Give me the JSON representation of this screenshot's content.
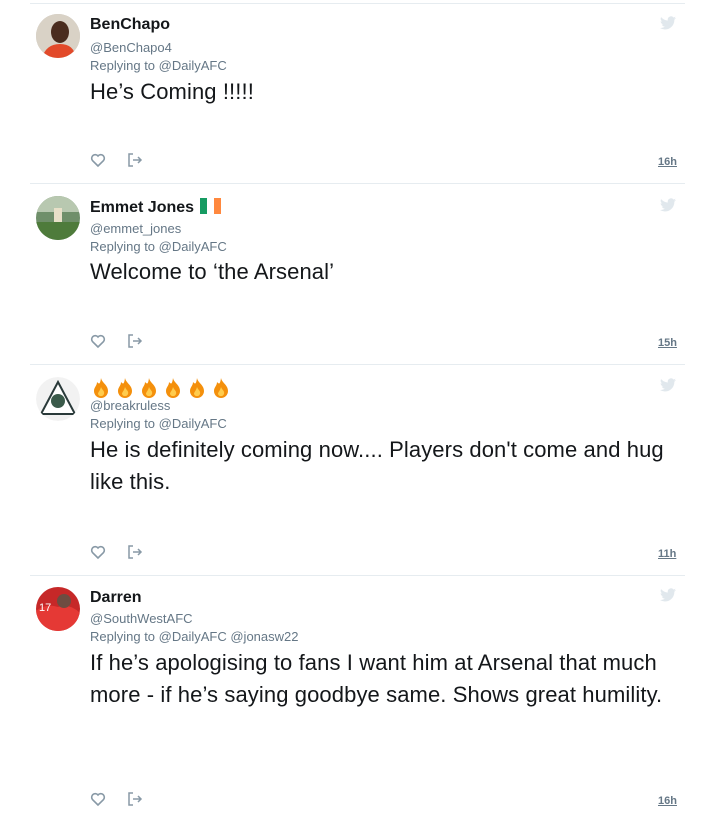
{
  "tweets": [
    {
      "name": "BenChapo",
      "handle": "@BenChapo4",
      "replying": "Replying to @DailyAFC",
      "text": "He’s Coming !!!!!",
      "time": "16h"
    },
    {
      "name": "Emmet Jones",
      "handle": "@emmet_jones",
      "replying": "Replying to @DailyAFC",
      "text": "Welcome to ‘the Arsenal’",
      "time": "15h"
    },
    {
      "name": "🔥🔥🔥🔥🔥🔥",
      "handle": "@breakruless",
      "replying": "Replying to @DailyAFC",
      "text": "He is definitely coming now.... Players don't come and hug like this.",
      "time": "11h"
    },
    {
      "name": "Darren",
      "handle": "@SouthWestAFC",
      "replying": "Replying to @DailyAFC @jonasw22",
      "text": "If he’s apologising to fans I want him at Arsenal that much more - if he’s saying goodbye same. Shows great humility.",
      "time": "16h"
    }
  ],
  "icons": {
    "bird": "twitter-bird-icon",
    "like": "heart-icon",
    "share": "share-icon"
  },
  "colors": {
    "muted": "#657786",
    "text": "#14171a",
    "icon": "#aab8c2",
    "fire": "#f4900c"
  }
}
